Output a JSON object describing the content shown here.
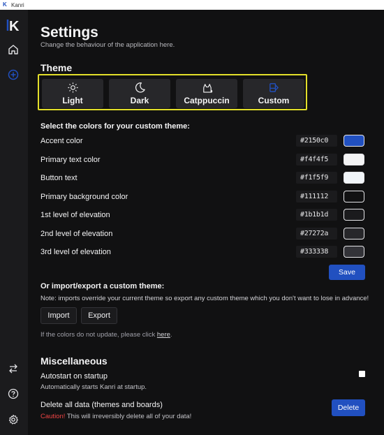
{
  "window": {
    "title": "Kanri"
  },
  "sidebar": {
    "logo_letter": "K",
    "items": [
      {
        "icon": "home-icon"
      },
      {
        "icon": "add-board-icon"
      }
    ],
    "bottom_items": [
      {
        "icon": "switch-icon"
      },
      {
        "icon": "help-icon"
      },
      {
        "icon": "settings-icon"
      }
    ]
  },
  "header": {
    "title": "Settings",
    "subtitle": "Change the behaviour of the application here."
  },
  "theme": {
    "heading": "Theme",
    "options": [
      {
        "label": "Light",
        "icon": "sun-icon"
      },
      {
        "label": "Dark",
        "icon": "moon-icon"
      },
      {
        "label": "Catppuccin",
        "icon": "cat-icon"
      },
      {
        "label": "Custom",
        "icon": "palette-icon",
        "accent": "#2150c0"
      }
    ],
    "selection_border_color": "#e3df2a"
  },
  "custom_theme": {
    "heading": "Select the colors for your custom theme:",
    "rows": [
      {
        "label": "Accent color",
        "hex": "#2150c0"
      },
      {
        "label": "Primary text color",
        "hex": "#f4f4f5"
      },
      {
        "label": "Button text",
        "hex": "#f1f5f9"
      },
      {
        "label": "Primary background color",
        "hex": "#111112"
      },
      {
        "label": "1st level of elevation",
        "hex": "#1b1b1d"
      },
      {
        "label": "2nd level of elevation",
        "hex": "#27272a"
      },
      {
        "label": "3rd level of elevation",
        "hex": "#333338"
      }
    ],
    "save_label": "Save"
  },
  "import_export": {
    "heading": "Or import/export a custom theme:",
    "note": "Note: imports override your current theme so export any custom theme which you don't want to lose in advance!",
    "import_label": "Import",
    "export_label": "Export",
    "update_hint_prefix": "If the colors do not update, please click ",
    "update_hint_link": "here",
    "update_hint_suffix": "."
  },
  "misc": {
    "heading": "Miscellaneous",
    "autostart_label": "Autostart on startup",
    "autostart_desc": "Automatically starts Kanri at startup.",
    "autostart_checked": false,
    "delete_label": "Delete all data (themes and boards)",
    "delete_caution": "Caution!",
    "delete_desc": " This will irreversibly delete all of your data!",
    "delete_button": "Delete"
  }
}
